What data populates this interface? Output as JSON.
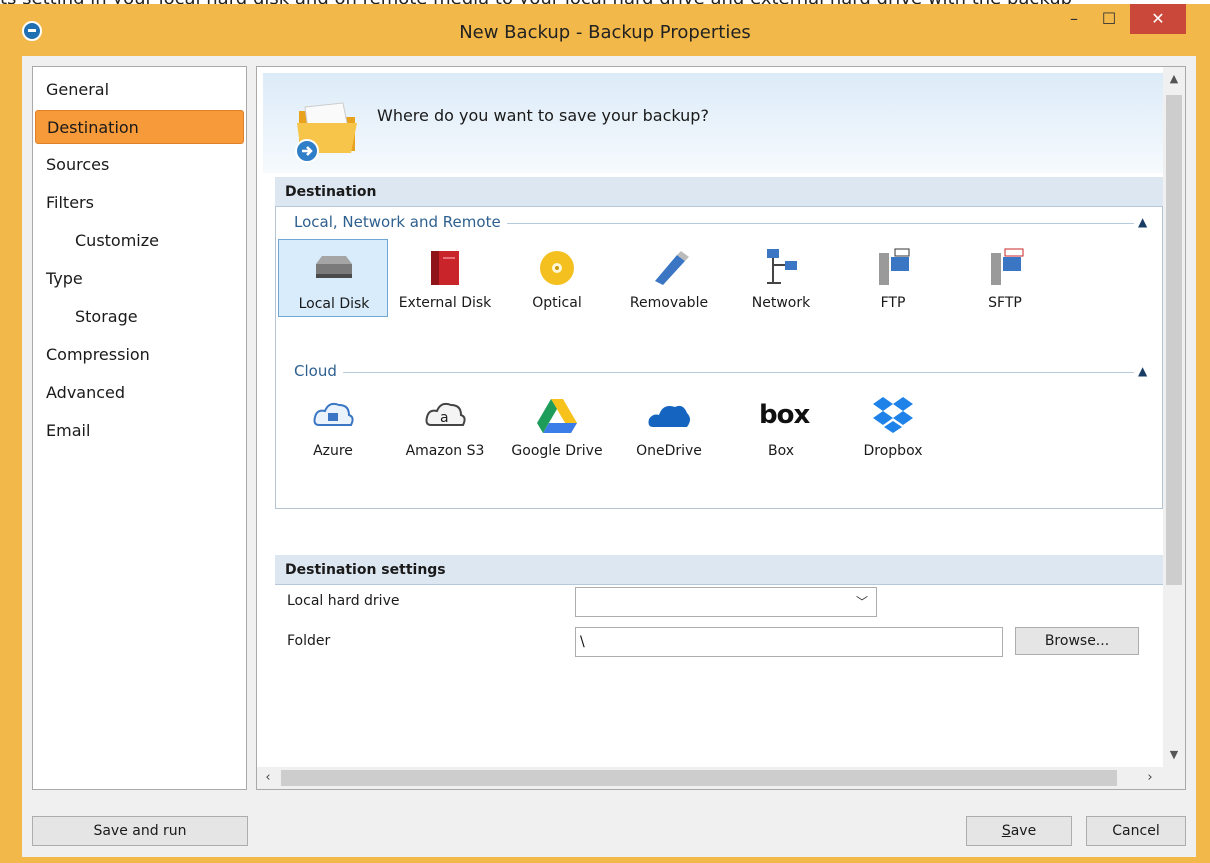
{
  "background_window": {
    "visible_text": "ts setting in your local hard disk and on remote media to your local hard drive and external hard drive with the backup"
  },
  "window": {
    "title": "New Backup - Backup Properties",
    "controls": {
      "minimize": "–",
      "maximize": "☐",
      "close": "✕"
    }
  },
  "nav": {
    "items": [
      {
        "label": "General",
        "level": 0,
        "active": false
      },
      {
        "label": "Destination",
        "level": 0,
        "active": true
      },
      {
        "label": "Sources",
        "level": 0,
        "active": false
      },
      {
        "label": "Filters",
        "level": 0,
        "active": false
      },
      {
        "label": "Customize",
        "level": 1,
        "active": false
      },
      {
        "label": "Type",
        "level": 0,
        "active": false
      },
      {
        "label": "Storage",
        "level": 1,
        "active": false
      },
      {
        "label": "Compression",
        "level": 0,
        "active": false
      },
      {
        "label": "Advanced",
        "level": 0,
        "active": false
      },
      {
        "label": "Email",
        "level": 0,
        "active": false
      }
    ]
  },
  "header": {
    "question": "Where do you want to save your backup?"
  },
  "destination": {
    "section_title": "Destination",
    "groups": [
      {
        "label": "Local, Network and Remote",
        "items": [
          {
            "label": "Local Disk",
            "icon": "local-disk-icon",
            "selected": true
          },
          {
            "label": "External Disk",
            "icon": "external-disk-icon",
            "selected": false
          },
          {
            "label": "Optical",
            "icon": "optical-disc-icon",
            "selected": false
          },
          {
            "label": "Removable",
            "icon": "usb-drive-icon",
            "selected": false
          },
          {
            "label": "Network",
            "icon": "network-icon",
            "selected": false
          },
          {
            "label": "FTP",
            "icon": "ftp-server-icon",
            "selected": false
          },
          {
            "label": "SFTP",
            "icon": "sftp-server-icon",
            "selected": false
          }
        ]
      },
      {
        "label": "Cloud",
        "items": [
          {
            "label": "Azure",
            "icon": "azure-cloud-icon",
            "selected": false
          },
          {
            "label": "Amazon S3",
            "icon": "amazon-s3-icon",
            "selected": false
          },
          {
            "label": "Google Drive",
            "icon": "google-drive-icon",
            "selected": false
          },
          {
            "label": "OneDrive",
            "icon": "onedrive-icon",
            "selected": false
          },
          {
            "label": "Box",
            "icon": "box-logo-icon",
            "selected": false,
            "logo_text": "box"
          },
          {
            "label": "Dropbox",
            "icon": "dropbox-icon",
            "selected": false
          }
        ]
      }
    ]
  },
  "destination_settings": {
    "section_title": "Destination settings",
    "drive_label": "Local hard drive",
    "drive_value": "",
    "folder_label": "Folder",
    "folder_value": "\\",
    "browse_label": "Browse..."
  },
  "footer": {
    "save_and_run": "Save and run",
    "save": "Save",
    "cancel": "Cancel"
  },
  "colors": {
    "window_frame": "#f2b94a",
    "nav_active": "#f79a3a",
    "section_header": "#dde7f1",
    "group_label": "#2d5f8f",
    "close_button": "#c9483a"
  }
}
